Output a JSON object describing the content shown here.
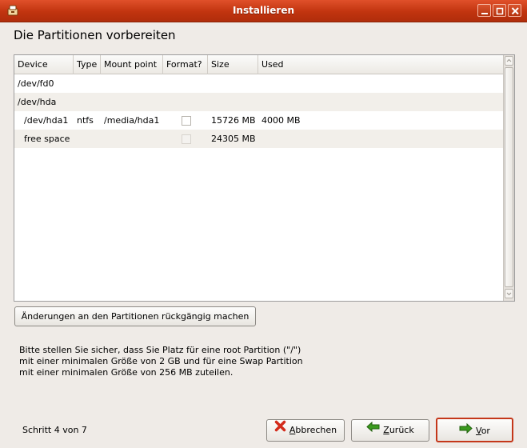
{
  "window": {
    "title": "Installieren"
  },
  "page": {
    "title": "Die Partitionen vorbereiten"
  },
  "table": {
    "columns": [
      "Device",
      "Type",
      "Mount point",
      "Format?",
      "Size",
      "Used"
    ],
    "rows": [
      {
        "device": "/dev/fd0",
        "type": "",
        "mount": "",
        "format": null,
        "size": "",
        "used": ""
      },
      {
        "device": "/dev/hda",
        "type": "",
        "mount": "",
        "format": null,
        "size": "",
        "used": ""
      },
      {
        "device": "/dev/hda1",
        "type": "ntfs",
        "mount": "/media/hda1",
        "format": false,
        "size": "15726 MB",
        "used": "4000 MB"
      },
      {
        "device": "free space",
        "type": "",
        "mount": "",
        "format": false,
        "size": "24305 MB",
        "used": ""
      }
    ]
  },
  "reset_button": {
    "label": "Änderungen an den Partitionen rückgängig machen"
  },
  "info_text": "Bitte stellen Sie sicher, dass Sie Platz für eine root Partition (\"/\") mit einer minimalen Größe von 2 GB und für eine Swap Partition mit einer minimalen Größe von 256 MB zuteilen.",
  "step_text": "Schritt 4 von 7",
  "buttons": {
    "cancel": {
      "mnemonic": "A",
      "rest": "bbrechen"
    },
    "back": {
      "mnemonic": "Z",
      "rest": "urück"
    },
    "next": {
      "mnemonic": "V",
      "rest": "or"
    }
  },
  "icons": {
    "app": "installer-icon",
    "minimize": "minimize-icon",
    "maximize": "maximize-icon",
    "close": "close-icon",
    "cancel": "red-x-icon",
    "back": "green-left-arrow-icon",
    "next": "green-right-arrow-icon"
  },
  "colors": {
    "titlebar": "#c1340f",
    "focus_border": "#c4371a",
    "arrow_green": "#3a9a1d",
    "cancel_red": "#d32b1b"
  }
}
